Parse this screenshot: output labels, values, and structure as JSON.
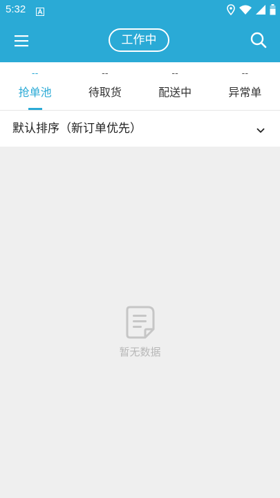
{
  "status_bar": {
    "time": "5:32",
    "app_icon": "a-letter-icon",
    "icons": [
      "location-icon",
      "wifi-icon",
      "signal-icon",
      "battery-icon"
    ]
  },
  "app_bar": {
    "menu_icon": "menu-icon",
    "status_label": "工作中",
    "search_icon": "search-icon"
  },
  "tabs": [
    {
      "count": "--",
      "label": "抢单池",
      "active": true
    },
    {
      "count": "--",
      "label": "待取货",
      "active": false
    },
    {
      "count": "--",
      "label": "配送中",
      "active": false
    },
    {
      "count": "--",
      "label": "异常单",
      "active": false
    }
  ],
  "sort": {
    "label": "默认排序（新订单优先）",
    "icon": "chevron-down-icon"
  },
  "empty_state": {
    "icon": "document-icon",
    "text": "暂无数据"
  },
  "colors": {
    "primary": "#2aaad6",
    "background": "#efefef",
    "empty_text": "#b8b8b8"
  }
}
